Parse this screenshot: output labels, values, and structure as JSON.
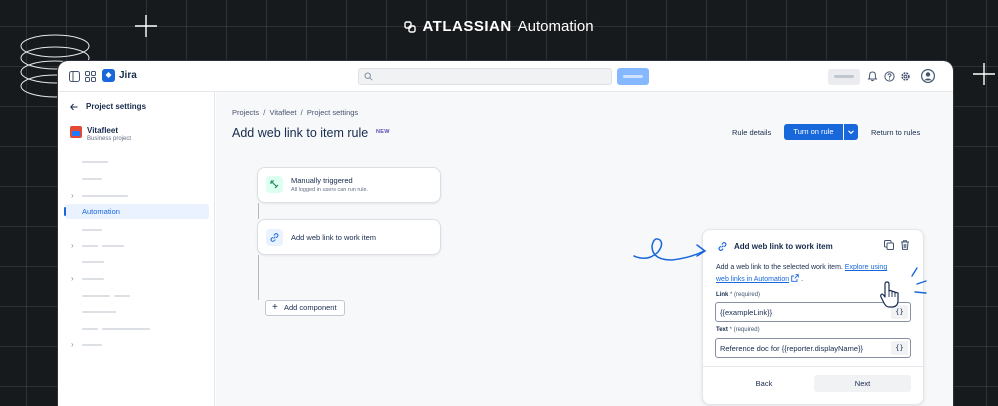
{
  "brand": {
    "name": "ATLASSIAN",
    "product": "Automation"
  },
  "app": {
    "name": "Jira"
  },
  "sidebar": {
    "back_label": "Project settings",
    "project_name": "Vitafleet",
    "project_type": "Business project",
    "active_item": "Automation"
  },
  "main": {
    "breadcrumb": "Projects  /  Vitafleet  /  Project settings",
    "title": "Add web link to item rule",
    "badge": "NEW",
    "actions": {
      "rule_details": "Rule details",
      "turn_on": "Turn on rule",
      "return": "Return to rules"
    },
    "trigger": {
      "title": "Manually triggered",
      "subtitle": "All logged in users can run rule."
    },
    "action": {
      "title": "Add web link to work item"
    },
    "add_component": "Add component"
  },
  "panel": {
    "title": "Add web link to work item",
    "desc_prefix": "Add a web link to the selected work item.",
    "link_text_1": "Explore using",
    "link_text_2": "web links in Automation",
    "desc_suffix": ".",
    "link_field": {
      "label": "Link",
      "required": "* (required)",
      "value": "{{exampleLink}}"
    },
    "text_field": {
      "label": "Text",
      "required": "* (required)",
      "value": "Reference doc for {{reporter.displayName}}"
    },
    "brace": "{}",
    "back": "Back",
    "next": "Next"
  },
  "colors": {
    "accent": "#1868db",
    "background": "#161a1d"
  }
}
